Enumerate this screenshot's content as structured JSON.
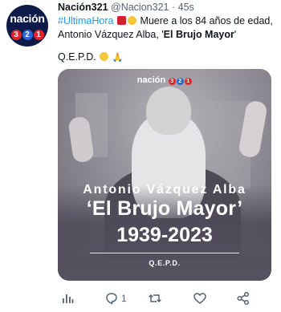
{
  "account": {
    "avatar_word": "nación",
    "avatar_digits": [
      "3",
      "2",
      "1"
    ],
    "name": "Nación321",
    "handle": "@Nacion321",
    "separator": "·",
    "time": "45s"
  },
  "tweet": {
    "hashtag": "#UltimaHora",
    "text_part1": "Muere a los 84 años de edad, Antonio Vázquez Alba, '",
    "bold_alias": "El Brujo Mayor",
    "text_part2": "'",
    "line2": "Q.E.P.D."
  },
  "media": {
    "logo_word": "nación",
    "logo_digits": [
      "3",
      "2",
      "1"
    ],
    "name": "Antonio Vázquez Alba",
    "alias": "‘El Brujo Mayor’",
    "years": "1939-2023",
    "footer": "Q.E.P.D."
  },
  "actions": {
    "replies": "1",
    "retweets": "",
    "likes": ""
  },
  "colors": {
    "link": "#1d9bf0",
    "muted": "#536471",
    "text": "#0f1419",
    "brand_navy": "#0d1a4a",
    "brand_red": "#e0252b",
    "brand_blue": "#2a66d3"
  },
  "icons": [
    "views-icon",
    "reply-icon",
    "retweet-icon",
    "like-icon",
    "share-icon"
  ]
}
